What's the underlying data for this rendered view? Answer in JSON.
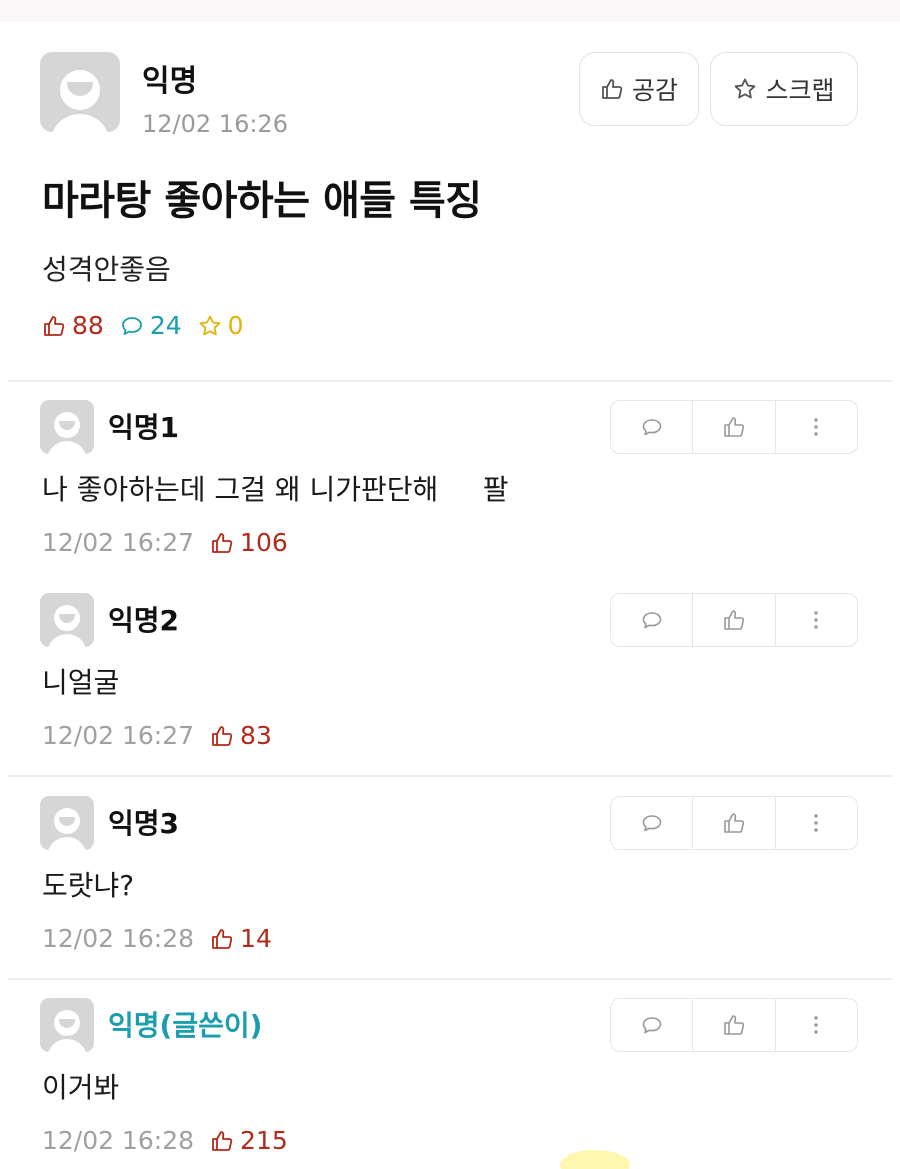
{
  "post": {
    "author": "익명",
    "time": "12/02 16:26",
    "like_button": "공감",
    "scrap_button": "스크랩",
    "title": "마라탕 좋아하는 애들 특징",
    "body": "성격안좋음",
    "likes": "88",
    "comments": "24",
    "scraps": "0"
  },
  "comments": [
    {
      "author": "익명1",
      "text": "나 좋아하는데 그걸 왜 니가판단해     팔",
      "time": "12/02 16:27",
      "likes": "106"
    },
    {
      "author": "익명2",
      "text": "니얼굴",
      "time": "12/02 16:27",
      "likes": "83"
    },
    {
      "author": "익명3",
      "text": "도랏냐?",
      "time": "12/02 16:28",
      "likes": "14"
    },
    {
      "author": "익명(글쓴이)",
      "text": "이거봐",
      "time": "12/02 16:28",
      "likes": "215"
    }
  ],
  "colors": {
    "like_red": "#b22a1a",
    "comment_teal": "#1a9dad",
    "scrap_yellow": "#e0b40a",
    "op_teal": "#1a9dad"
  },
  "icons": {
    "like": "thumbs-up-icon",
    "comment": "speech-bubble-icon",
    "scrap": "star-icon",
    "more": "vertical-dots-icon"
  }
}
